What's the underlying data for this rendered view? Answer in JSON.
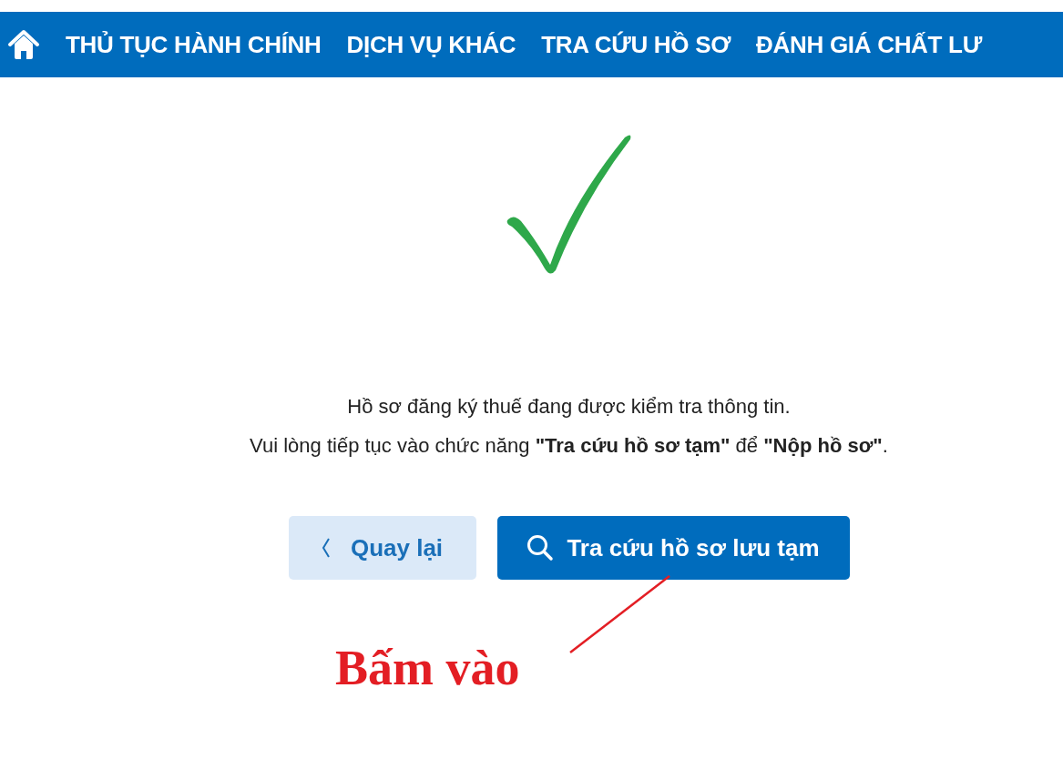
{
  "nav": {
    "items": [
      {
        "label": "THỦ TỤC HÀNH CHÍNH"
      },
      {
        "label": "DỊCH VỤ KHÁC"
      },
      {
        "label": "TRA CỨU HỒ SƠ"
      },
      {
        "label": "ĐÁNH GIÁ CHẤT LƯ"
      }
    ]
  },
  "message": [
    "Hồ sơ đăng ký thuế đang được kiểm tra thông tin.",
    "Vui lòng tiếp tục vào chức năng **\"Tra cứu hồ sơ tạm\"** để **\"Nộp hồ sơ\"**."
  ],
  "buttons": [
    {
      "kind": "back",
      "label": "Quay lại"
    },
    {
      "kind": "search",
      "label": "Tra cứu hồ sơ lưu tạm"
    }
  ],
  "annotation": {
    "text": "Bấm vào"
  }
}
